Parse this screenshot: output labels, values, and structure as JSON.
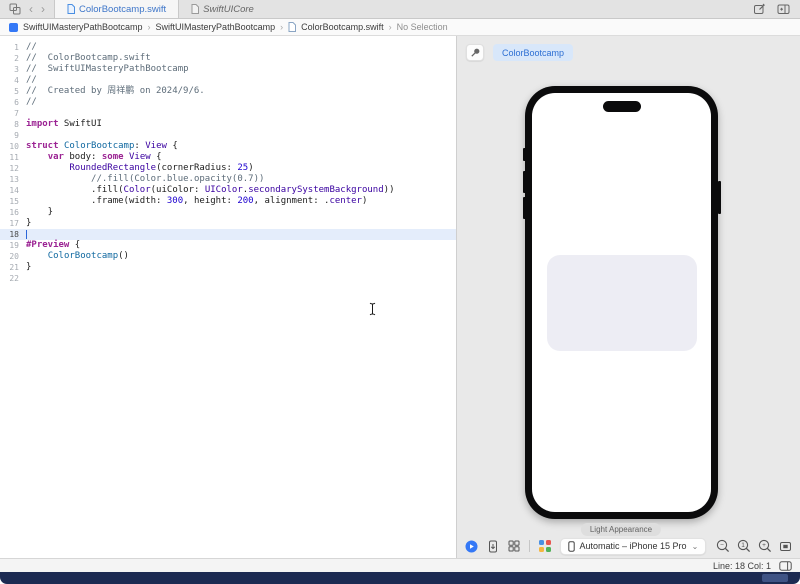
{
  "icons": {
    "chevron_left": "‹",
    "chevron_right": "›",
    "chevron_down": "⌄",
    "breadcrumb_separator": "›"
  },
  "tabbar": {
    "tabs": [
      {
        "label": "ColorBootcamp.swift",
        "active": true
      },
      {
        "label": "SwiftUICore",
        "active": false
      }
    ]
  },
  "breadcrumb": {
    "items": [
      "SwiftUIMasteryPathBootcamp",
      "SwiftUIMasteryPathBootcamp",
      "ColorBootcamp.swift",
      "No Selection"
    ]
  },
  "editor": {
    "current_line": 18,
    "lines": [
      [
        [
          "c",
          "//"
        ]
      ],
      [
        [
          "c",
          "//  ColorBootcamp.swift"
        ]
      ],
      [
        [
          "c",
          "//  SwiftUIMasteryPathBootcamp"
        ]
      ],
      [
        [
          "c",
          "//"
        ]
      ],
      [
        [
          "c",
          "//  Created by 周祥鹏 on 2024/9/6."
        ]
      ],
      [
        [
          "c",
          "//"
        ]
      ],
      [],
      [
        [
          "k",
          "import"
        ],
        [
          "p",
          " SwiftUI"
        ]
      ],
      [],
      [
        [
          "k",
          "struct"
        ],
        [
          "p",
          " "
        ],
        [
          "d",
          "ColorBootcamp"
        ],
        [
          "p",
          ": "
        ],
        [
          "t",
          "View"
        ],
        [
          "p",
          " {"
        ]
      ],
      [
        [
          "p",
          "    "
        ],
        [
          "k",
          "var"
        ],
        [
          "p",
          " body: "
        ],
        [
          "k",
          "some"
        ],
        [
          "p",
          " "
        ],
        [
          "t",
          "View"
        ],
        [
          "p",
          " {"
        ]
      ],
      [
        [
          "p",
          "        "
        ],
        [
          "t",
          "RoundedRectangle"
        ],
        [
          "p",
          "(cornerRadius: "
        ],
        [
          "n",
          "25"
        ],
        [
          "p",
          ")"
        ]
      ],
      [
        [
          "c",
          "            //.fill(Color.blue.opacity(0.7))"
        ]
      ],
      [
        [
          "p",
          "            .fill("
        ],
        [
          "t",
          "Color"
        ],
        [
          "p",
          "(uiColor: "
        ],
        [
          "t",
          "UIColor"
        ],
        [
          "p",
          "."
        ],
        [
          "t",
          "secondarySystemBackground"
        ],
        [
          "p",
          "))"
        ]
      ],
      [
        [
          "p",
          "            .frame(width: "
        ],
        [
          "n",
          "300"
        ],
        [
          "p",
          ", height: "
        ],
        [
          "n",
          "200"
        ],
        [
          "p",
          ", alignment: ."
        ],
        [
          "t",
          "center"
        ],
        [
          "p",
          ")"
        ]
      ],
      [
        [
          "p",
          "    }"
        ]
      ],
      [
        [
          "p",
          "}"
        ]
      ],
      [],
      [
        [
          "k",
          "#Preview"
        ],
        [
          "p",
          " {"
        ]
      ],
      [
        [
          "p",
          "    "
        ],
        [
          "d",
          "ColorBootcamp"
        ],
        [
          "p",
          "()"
        ]
      ],
      [
        [
          "p",
          "}"
        ]
      ],
      []
    ]
  },
  "canvas": {
    "preview_badge": "ColorBootcamp",
    "appearance_label": "Light Appearance",
    "device_selector": "Automatic – iPhone 15 Pro",
    "zoom": [
      "−",
      "1",
      "+"
    ]
  },
  "statusbar": {
    "line_col": "Line: 18  Col: 1"
  },
  "colors": {
    "accent_blue": "#3478F6",
    "badge_bg": "#D8E7FA",
    "preview_rectangle": "#EDEDF4",
    "dock": "#1C2A52"
  }
}
